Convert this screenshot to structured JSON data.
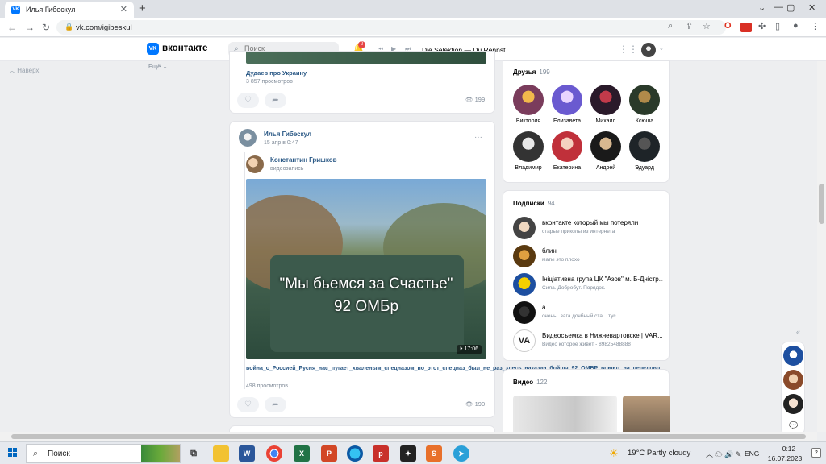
{
  "browser": {
    "tab_title": "Илья Гибескул",
    "url": "vk.com/igibeskul"
  },
  "vk": {
    "logo_text": "вконтакте",
    "search_placeholder": "Поиск",
    "notifications_count": "2",
    "now_playing": "Die Selektion — Du Rennst"
  },
  "left_nav": {
    "up_label": "Наверх",
    "more_label": "Ещё"
  },
  "feed": {
    "post1": {
      "video_title": "Дудаев про Украину",
      "video_views": "3 857 просмотров",
      "views": "199"
    },
    "post2": {
      "author": "Илья Гибескул",
      "date": "15 апр в 0:47",
      "repost_author": "Константин Гришков",
      "repost_sub": "видеозапись",
      "video_caption_line1": "\"Мы бьемся за Счастье\"",
      "video_caption_line2": "92 ОМБр",
      "video_duration": "17:06",
      "video_title": "война_с_Россией_Русня_нас_пугает_хваленым_спецназом_но_этот_спецназ_был_не_раз_здесь_наказан_бойцы_92_ОМБР_воюют_на_передово",
      "video_views": "498 просмотров",
      "views": "190"
    }
  },
  "friends": {
    "title": "Друзья",
    "count": "199",
    "items": [
      {
        "name": "Виктория"
      },
      {
        "name": "Елизавета"
      },
      {
        "name": "Михаил"
      },
      {
        "name": "Ксюша"
      },
      {
        "name": "Владимир"
      },
      {
        "name": "Екатерина"
      },
      {
        "name": "Андрей"
      },
      {
        "name": "Эдуард"
      }
    ]
  },
  "subscriptions": {
    "title": "Подписки",
    "count": "94",
    "items": [
      {
        "name": "вконтакте который мы потеряли",
        "desc": "старые приколы из интернета"
      },
      {
        "name": "блин",
        "desc": "маты это плохо"
      },
      {
        "name": "Ініціативна група ЦК \"Азов\" м. Б-Дністр...",
        "desc": "Сила. Добробут. Порядок."
      },
      {
        "name": "а",
        "desc": "очень.. зага дочбный ста... тус..."
      },
      {
        "name": "Видеосъемка в Нижневартовске | VAR...",
        "desc": "Видео которое живёт - 89825488888"
      }
    ]
  },
  "videos": {
    "title": "Видео",
    "count": "122"
  },
  "taskbar": {
    "search_label": "Поиск",
    "weather": "19°C  Partly cloudy",
    "lang": "ENG",
    "time": "0:12",
    "date": "16.07.2023",
    "notif_count": "2"
  }
}
